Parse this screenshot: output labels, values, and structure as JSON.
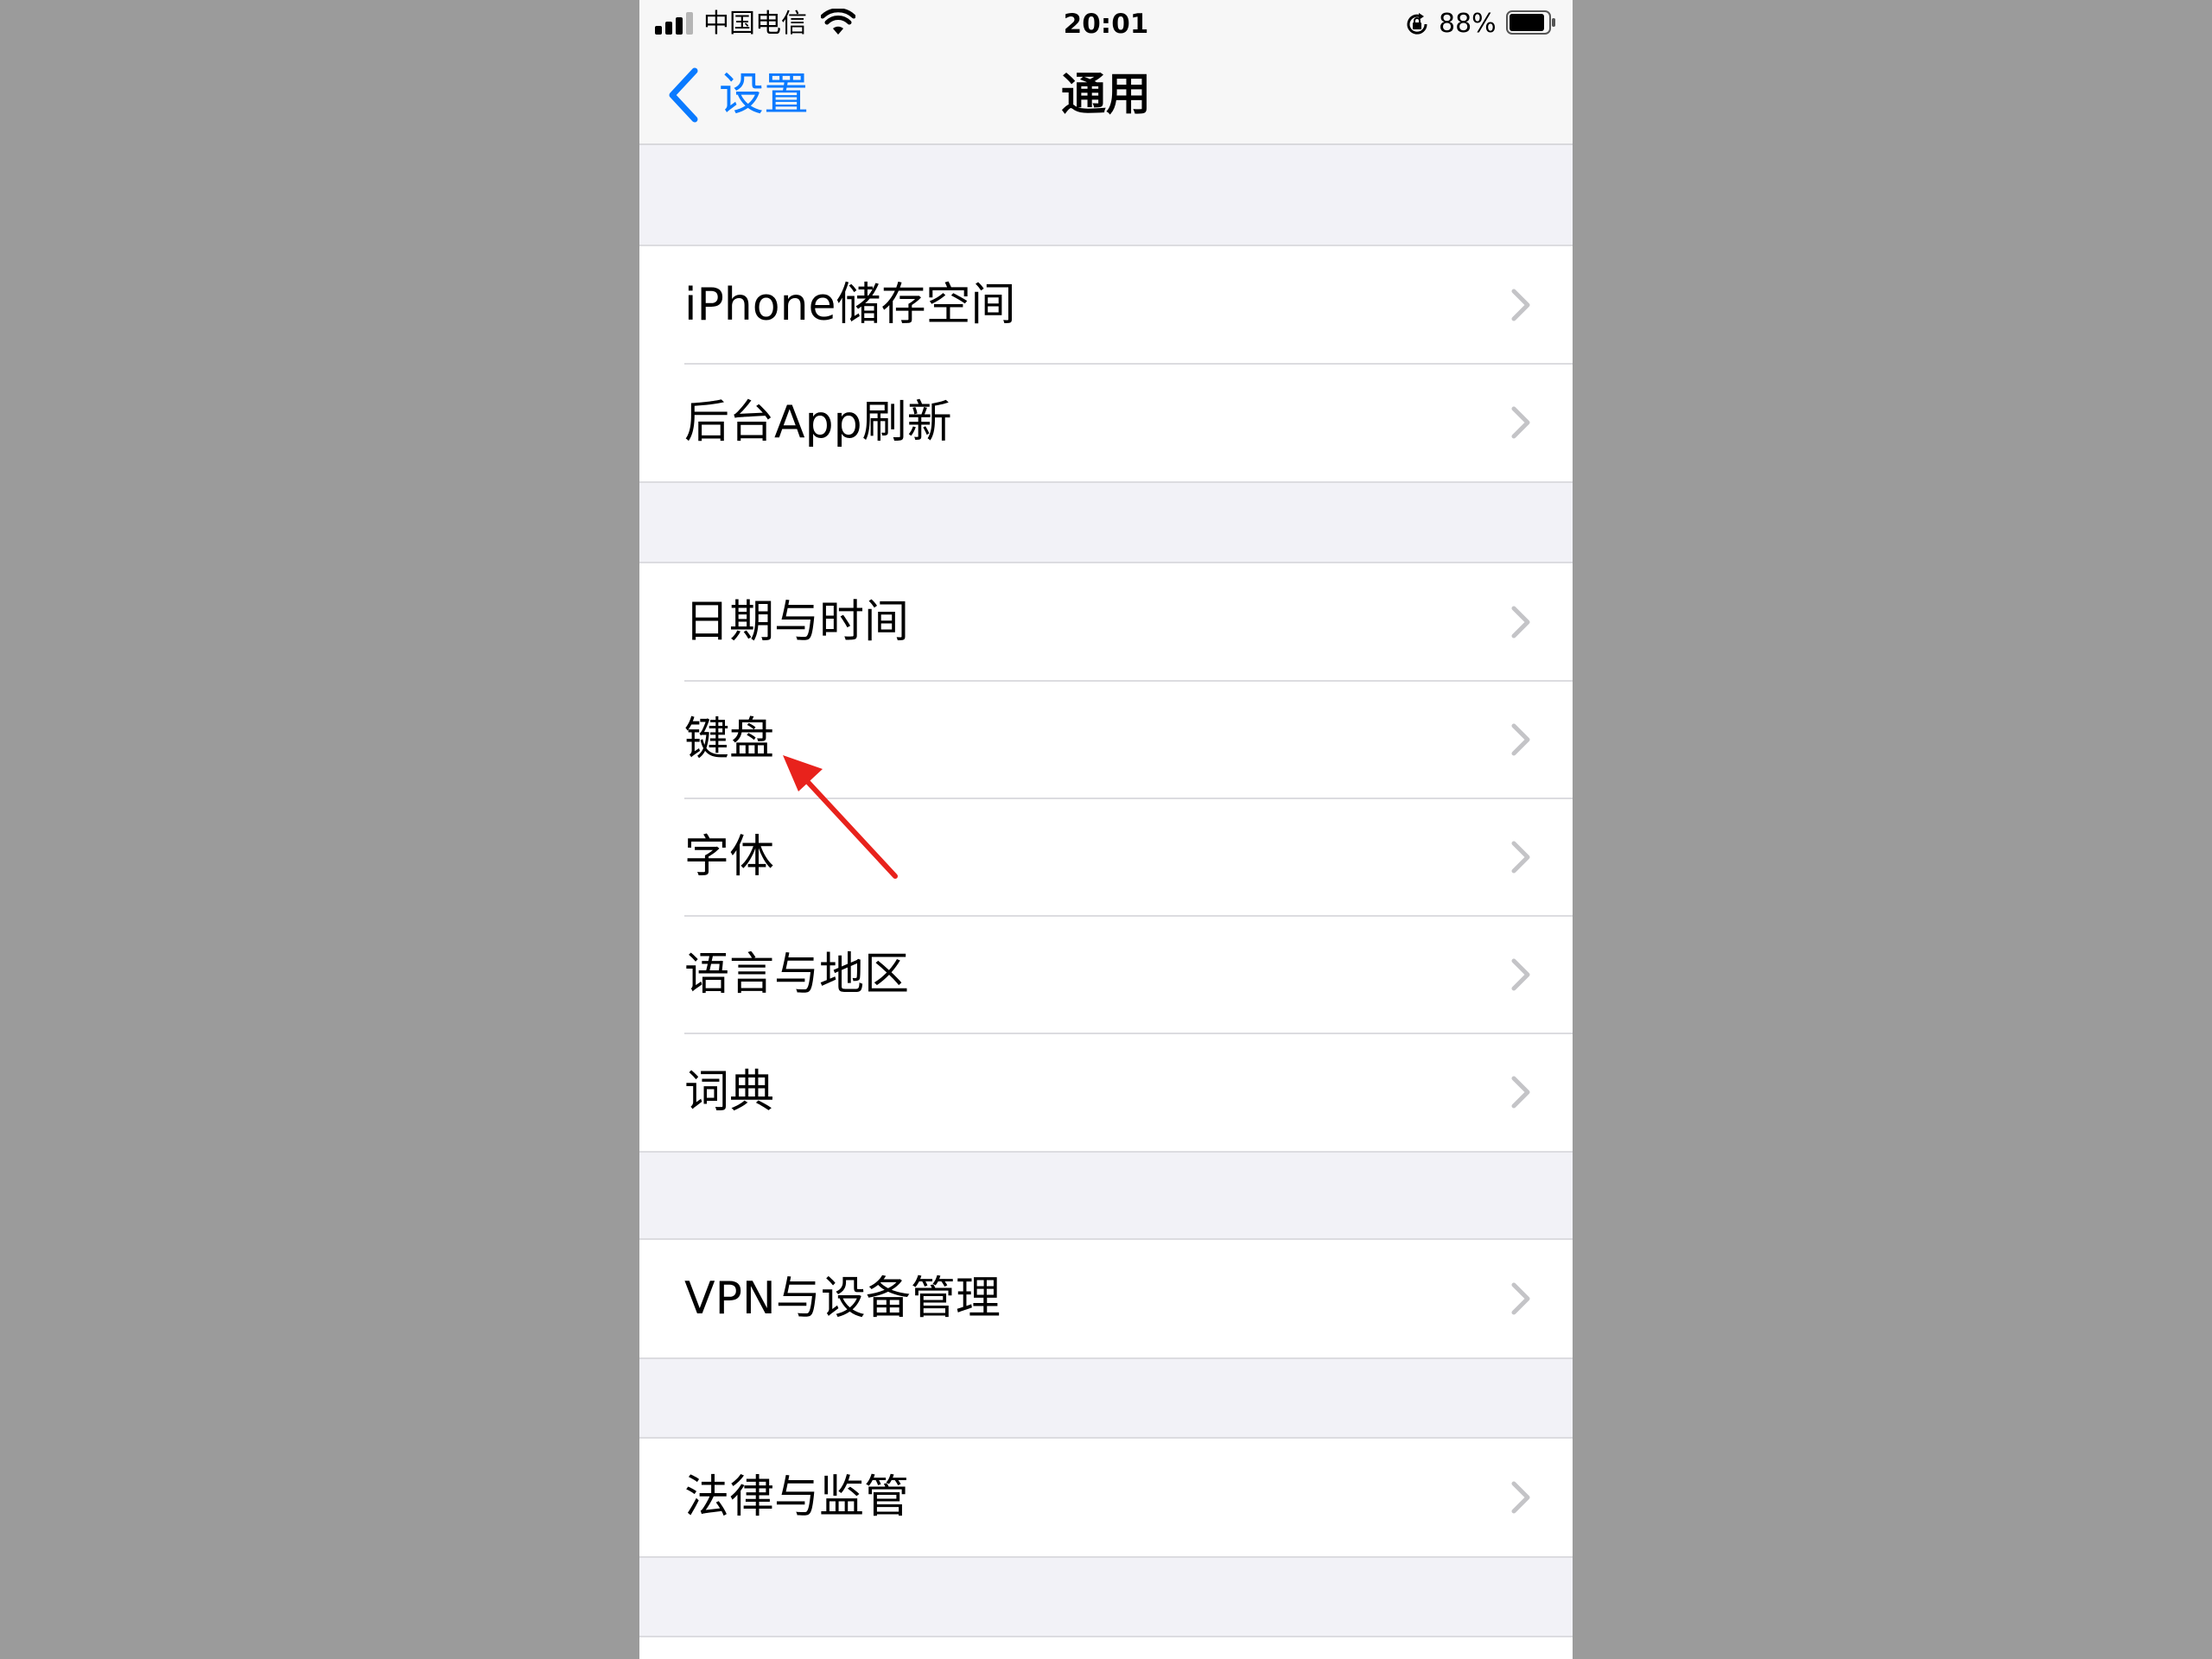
{
  "status_bar": {
    "carrier": "中国电信",
    "time": "20:01",
    "battery_percent": "88%"
  },
  "nav": {
    "back_label": "设置",
    "title": "通用"
  },
  "groups": [
    {
      "items": [
        {
          "label": "iPhone储存空间"
        },
        {
          "label": "后台App刷新"
        }
      ]
    },
    {
      "items": [
        {
          "label": "日期与时间"
        },
        {
          "label": "键盘"
        },
        {
          "label": "字体"
        },
        {
          "label": "语言与地区"
        },
        {
          "label": "词典"
        }
      ]
    },
    {
      "items": [
        {
          "label": "VPN与设备管理"
        }
      ]
    },
    {
      "items": [
        {
          "label": "法律与监管"
        }
      ]
    }
  ],
  "colors": {
    "accent": "#0a7aff",
    "annotation": "#e8221c",
    "chevron": "#c4c4c7"
  }
}
